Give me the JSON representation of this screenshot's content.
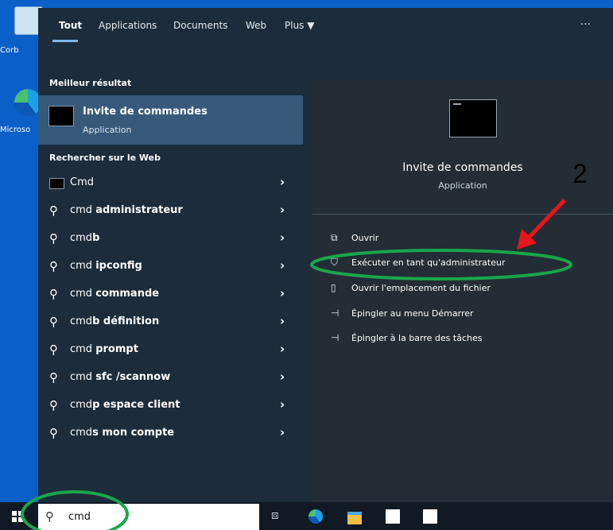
{
  "desktop": {
    "icons": [
      {
        "label": "Corb"
      },
      {
        "label": "Microso"
      }
    ]
  },
  "start": {
    "tabs": [
      {
        "label": "Tout"
      },
      {
        "label": "Applications"
      },
      {
        "label": "Documents"
      },
      {
        "label": "Web"
      },
      {
        "label": "Plus ▼"
      }
    ],
    "more": "···",
    "best_match_title": "Meilleur résultat",
    "best_match": {
      "name": "Invite de commandes",
      "type": "Application"
    },
    "web_title": "Rechercher sur le Web",
    "web_results": [
      {
        "prefix": "Cmd",
        "bold": ""
      },
      {
        "prefix": "cmd ",
        "bold": "administrateur"
      },
      {
        "prefix": "cmd",
        "bold": "b"
      },
      {
        "prefix": "cmd ",
        "bold": "ipconfig"
      },
      {
        "prefix": "cmd ",
        "bold": "commande"
      },
      {
        "prefix": "cmd",
        "bold": "b définition"
      },
      {
        "prefix": "cmd ",
        "bold": "prompt"
      },
      {
        "prefix": "cmd ",
        "bold": "sfc /scannow"
      },
      {
        "prefix": "cmd",
        "bold": "p espace client"
      },
      {
        "prefix": "cmd",
        "bold": "s mon compte"
      }
    ],
    "preview": {
      "name": "Invite de commandes",
      "type": "Application",
      "actions": [
        {
          "label": "Ouvrir",
          "icon": "open-icon"
        },
        {
          "label": "Exécuter en tant qu'administrateur",
          "icon": "run-as-admin-icon"
        },
        {
          "label": "Ouvrir l'emplacement du fichier",
          "icon": "file-location-icon"
        },
        {
          "label": "Épingler au menu Démarrer",
          "icon": "pin-icon"
        },
        {
          "label": "Épingler à la barre des tâches",
          "icon": "pin-icon"
        }
      ]
    }
  },
  "taskbar": {
    "search_value": "cmd"
  },
  "annotation": {
    "number": "2",
    "highlight_color": "#1aa64a",
    "arrow_color": "#e8141c"
  }
}
